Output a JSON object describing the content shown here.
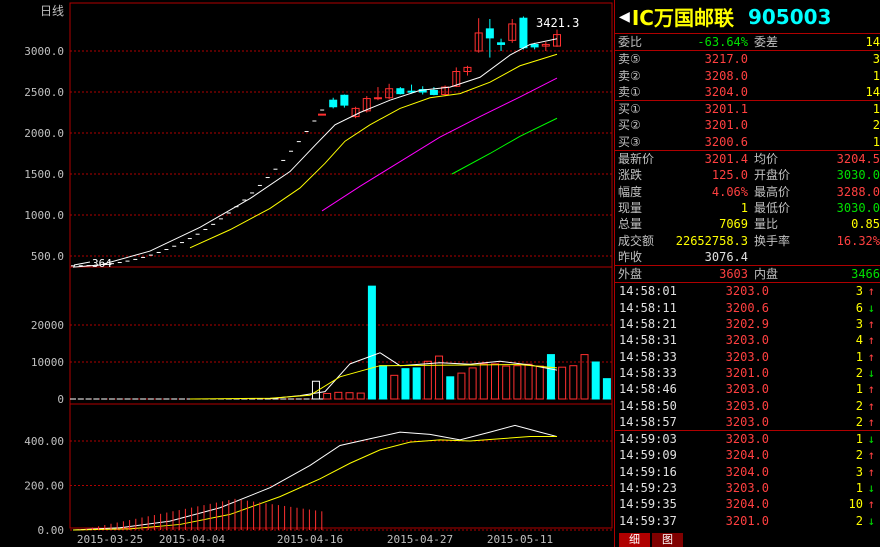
{
  "window": {
    "period_label": "日线"
  },
  "stock": {
    "back_arrow": "◀",
    "name": "IC万国邮联",
    "code": "905003"
  },
  "chart": {
    "max_label": "3421.3",
    "min_label": "364",
    "price_axis": [
      "3000.0",
      "2500.0",
      "2000.0",
      "1500.0",
      "1000.0",
      "500.0"
    ],
    "vol_axis": [
      "20000",
      "10000",
      "0"
    ],
    "ind_axis": [
      "400.00",
      "200.00",
      "0.00"
    ],
    "dates": [
      "2015-03-25",
      "2015-04-04",
      "2015-04-16",
      "2015-04-27",
      "2015-05-11"
    ],
    "colors": {
      "up": "#ff3030",
      "down": "#00ffff",
      "ma5": "#ffffff",
      "ma10": "#ffff00",
      "ma20": "#ff00ff",
      "ma30": "#00ff00",
      "grid": "#b00000"
    }
  },
  "chart_data": {
    "type": "candlestick",
    "price_ylim": [
      364,
      3421.3
    ],
    "candles": [
      {
        "o": 2230,
        "c": 2230,
        "h": 2230,
        "l": 2230
      },
      {
        "o": 2400,
        "c": 2320,
        "h": 2430,
        "l": 2300
      },
      {
        "o": 2460,
        "c": 2340,
        "h": 2470,
        "l": 2310
      },
      {
        "o": 2200,
        "c": 2300,
        "h": 2320,
        "l": 2180
      },
      {
        "o": 2270,
        "c": 2420,
        "h": 2450,
        "l": 2250
      },
      {
        "o": 2420,
        "c": 2430,
        "h": 2560,
        "l": 2400
      },
      {
        "o": 2430,
        "c": 2540,
        "h": 2600,
        "l": 2410
      },
      {
        "o": 2540,
        "c": 2480,
        "h": 2560,
        "l": 2470
      },
      {
        "o": 2510,
        "c": 2500,
        "h": 2590,
        "l": 2480
      },
      {
        "o": 2530,
        "c": 2500,
        "h": 2570,
        "l": 2470
      },
      {
        "o": 2520,
        "c": 2470,
        "h": 2560,
        "l": 2460
      },
      {
        "o": 2470,
        "c": 2560,
        "h": 2580,
        "l": 2450
      },
      {
        "o": 2570,
        "c": 2750,
        "h": 2800,
        "l": 2560
      },
      {
        "o": 2750,
        "c": 2800,
        "h": 2820,
        "l": 2700
      },
      {
        "o": 3000,
        "c": 3220,
        "h": 3400,
        "l": 2980
      },
      {
        "o": 3270,
        "c": 3160,
        "h": 3390,
        "l": 2920
      },
      {
        "o": 3100,
        "c": 3080,
        "h": 3150,
        "l": 3000
      },
      {
        "o": 3130,
        "c": 3330,
        "h": 3390,
        "l": 3100
      },
      {
        "o": 3400,
        "c": 3040,
        "h": 3421.3,
        "l": 3020
      },
      {
        "o": 3080,
        "c": 3050,
        "h": 3100,
        "l": 3020
      },
      {
        "o": 3060,
        "c": 3080,
        "h": 3110,
        "l": 3000
      },
      {
        "o": 3060,
        "c": 3200,
        "h": 3260,
        "l": 3050
      }
    ],
    "volume": [
      0,
      0,
      0,
      0,
      0,
      0,
      0,
      0,
      0,
      0,
      0,
      0,
      0,
      0,
      0,
      0,
      0,
      0,
      0,
      0,
      0,
      0,
      0,
      0,
      0,
      0,
      0,
      0,
      0,
      0,
      0,
      0,
      0,
      4800,
      1500,
      1800,
      1700,
      1600,
      30500,
      9000,
      6400,
      8200,
      8400,
      10200,
      11600,
      6000,
      7000,
      8400,
      9500,
      9500,
      8900,
      9000,
      9400,
      8900,
      12000,
      8600,
      9000,
      12000,
      10000,
      5500,
      3700,
      6900
    ],
    "indicator_ylim": [
      0,
      520
    ]
  },
  "panel": {
    "wb": {
      "label1": "委比",
      "value1": "-63.64%",
      "label2": "委差",
      "value2": "14"
    },
    "sells": [
      {
        "label": "卖⑤",
        "price": "3217.0",
        "qty": "3"
      },
      {
        "label": "卖②",
        "price": "3208.0",
        "qty": "1"
      },
      {
        "label": "卖①",
        "price": "3204.0",
        "qty": "14"
      }
    ],
    "buys": [
      {
        "label": "买①",
        "price": "3201.1",
        "qty": "1"
      },
      {
        "label": "买②",
        "price": "3201.0",
        "qty": "2"
      },
      {
        "label": "买③",
        "price": "3200.6",
        "qty": "1"
      }
    ],
    "quotes": [
      {
        "l1": "最新价",
        "v1": "3201.4",
        "l2": "均价",
        "v2": "3204.5"
      },
      {
        "l1": "涨跌",
        "v1": "125.0",
        "l2": "开盘价",
        "v2": "3030.0"
      },
      {
        "l1": "幅度",
        "v1": "4.06%",
        "l2": "最高价",
        "v2": "3288.0"
      },
      {
        "l1": "现量",
        "v1": "1",
        "l2": "最低价",
        "v2": "3030.0"
      },
      {
        "l1": "总量",
        "v1": "7069",
        "l2": "量比",
        "v2": "0.85"
      },
      {
        "l1": "成交额",
        "v1": "22652758.3",
        "l2": "换手率",
        "v2": "16.32%"
      },
      {
        "l1": "昨收",
        "v1": "3076.4",
        "l2": "",
        "v2": ""
      }
    ],
    "inout": {
      "l1": "外盘",
      "v1": "3603",
      "l2": "内盘",
      "v2": "3466"
    },
    "ticks": [
      {
        "t": "14:58:01",
        "p": "3203.0",
        "q": "3",
        "d": "↑"
      },
      {
        "t": "14:58:11",
        "p": "3200.6",
        "q": "6",
        "d": "↓"
      },
      {
        "t": "14:58:21",
        "p": "3202.9",
        "q": "3",
        "d": "↑"
      },
      {
        "t": "14:58:31",
        "p": "3203.0",
        "q": "4",
        "d": "↑"
      },
      {
        "t": "14:58:33",
        "p": "3203.0",
        "q": "1",
        "d": "↑"
      },
      {
        "t": "14:58:33",
        "p": "3201.0",
        "q": "2",
        "d": "↓"
      },
      {
        "t": "14:58:46",
        "p": "3203.0",
        "q": "1",
        "d": "↑"
      },
      {
        "t": "14:58:50",
        "p": "3203.0",
        "q": "2",
        "d": "↑"
      },
      {
        "t": "14:58:57",
        "p": "3203.0",
        "q": "2",
        "d": "↑"
      },
      {
        "t": "14:59:03",
        "p": "3203.0",
        "q": "1",
        "d": "↓"
      },
      {
        "t": "14:59:09",
        "p": "3204.0",
        "q": "2",
        "d": "↑"
      },
      {
        "t": "14:59:16",
        "p": "3204.0",
        "q": "3",
        "d": "↑"
      },
      {
        "t": "14:59:23",
        "p": "3203.0",
        "q": "1",
        "d": "↓"
      },
      {
        "t": "14:59:35",
        "p": "3204.0",
        "q": "10",
        "d": "↑"
      },
      {
        "t": "14:59:37",
        "p": "3201.0",
        "q": "2",
        "d": "↓"
      }
    ],
    "tabs": [
      "细",
      "图"
    ]
  }
}
